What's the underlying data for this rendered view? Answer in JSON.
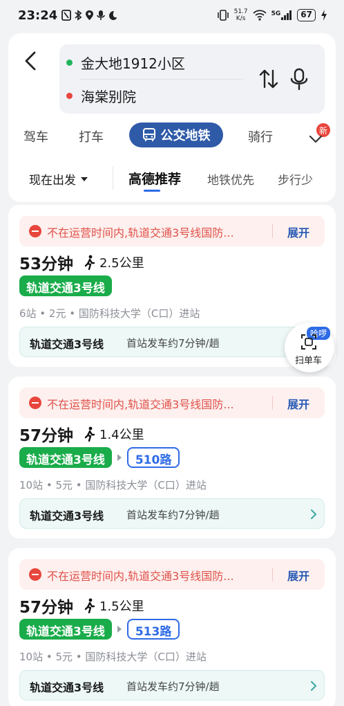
{
  "status": {
    "time": "23:24",
    "net_speed": "51.7\nK/s",
    "net_speed_top": "51.7",
    "net_speed_unit": "K/s",
    "signal": "5G",
    "battery": "67"
  },
  "search": {
    "origin": "金大地1912小区",
    "destination": "海棠别院"
  },
  "modes": [
    "驾车",
    "打车",
    "公交地铁",
    "骑行"
  ],
  "new_badge": "新",
  "filters": {
    "depart": "现在出发",
    "options": [
      "高德推荐",
      "地铁优先",
      "步行少"
    ]
  },
  "routes": [
    {
      "notice": "不在运营时间内,轨道交通3号线国防...",
      "expand": "展开",
      "duration": "53分钟",
      "walk": "2.5公里",
      "metro": "轨道交通3号线",
      "bus": "",
      "meta": "6站 • 2元 • 国防科技大学（C口）进站",
      "info_line": "轨道交通3号线",
      "info_text": "首站发车约7分钟/趟"
    },
    {
      "notice": "不在运营时间内,轨道交通3号线国防...",
      "expand": "展开",
      "duration": "57分钟",
      "walk": "1.4公里",
      "metro": "轨道交通3号线",
      "bus": "510路",
      "meta": "10站 • 5元 • 国防科技大学（C口）进站",
      "info_line": "轨道交通3号线",
      "info_text": "首站发车约7分钟/趟"
    },
    {
      "notice": "不在运营时间内,轨道交通3号线国防...",
      "expand": "展开",
      "duration": "57分钟",
      "walk": "1.5公里",
      "metro": "轨道交通3号线",
      "bus": "513路",
      "meta": "10站 • 5元 • 国防科技大学（C口）进站",
      "info_line": "轨道交通3号线",
      "info_text": "首站发车约7分钟/趟"
    }
  ],
  "scan": {
    "badge": "哈啰",
    "label": "扫单车"
  },
  "colors": {
    "origin_dot": "#21b45b",
    "destination_dot": "#e8453c",
    "active_mode": "#2e5aa8",
    "metro": "#1aac4a",
    "bus": "#2e6be6",
    "notice": "#e0514a"
  }
}
